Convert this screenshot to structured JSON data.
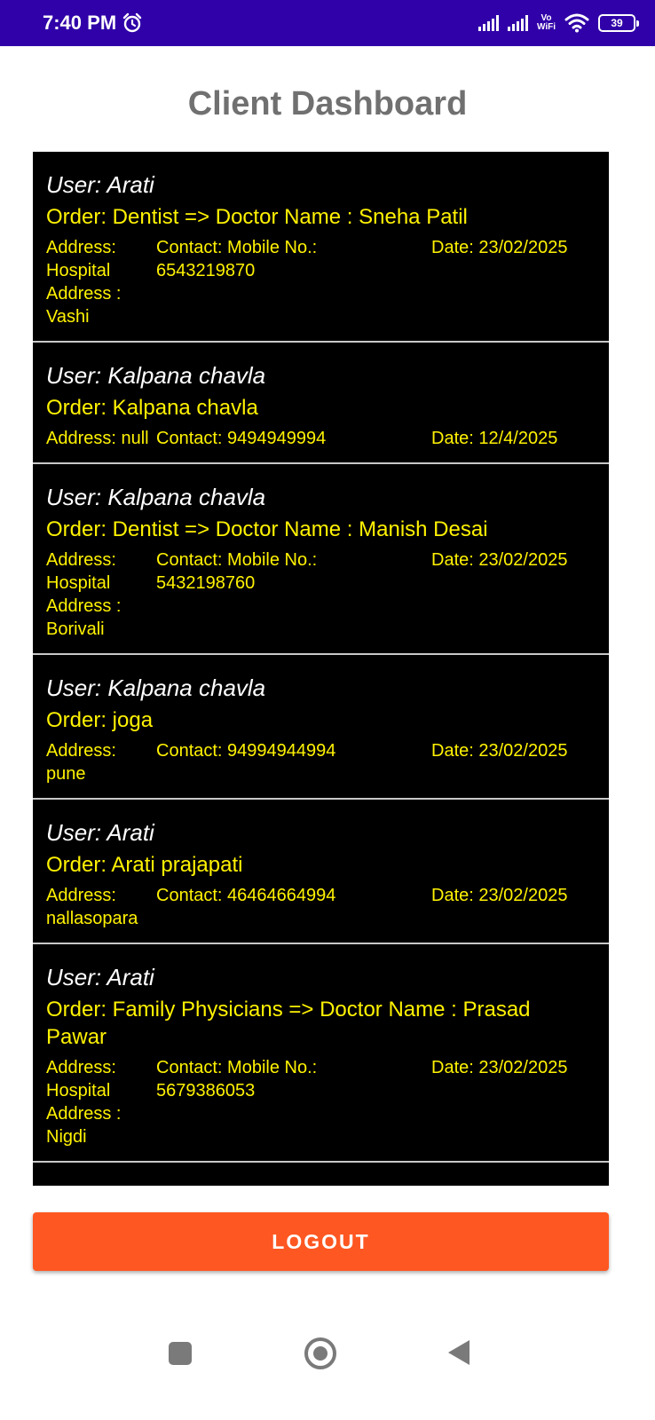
{
  "status_bar": {
    "time": "7:40 PM",
    "alarm_icon": "alarm-clock-icon",
    "vowifi_top": "Vo",
    "vowifi_bottom": "WiFi",
    "battery": "39"
  },
  "page": {
    "title": "Client Dashboard"
  },
  "orders": [
    {
      "user": "User: Arati",
      "order": "Order: Dentist => Doctor Name : Sneha Patil",
      "address": "Address: Hospital Address : Vashi",
      "contact": "Contact: Mobile No.: 6543219870",
      "date": "Date: 23/02/2025"
    },
    {
      "user": "User: Kalpana chavla",
      "order": "Order: Kalpana chavla",
      "address": "Address: null",
      "contact": "Contact: 9494949994",
      "date": "Date: 12/4/2025"
    },
    {
      "user": "User: Kalpana chavla",
      "order": "Order: Dentist => Doctor Name : Manish Desai",
      "address": "Address: Hospital Address : Borivali",
      "contact": "Contact: Mobile No.: 5432198760",
      "date": "Date: 23/02/2025"
    },
    {
      "user": "User: Kalpana chavla",
      "order": "Order: joga",
      "address": "Address: pune",
      "contact": "Contact: 94994944994",
      "date": "Date: 23/02/2025"
    },
    {
      "user": "User: Arati",
      "order": "Order: Arati prajapati",
      "address": "Address: nallasopara",
      "contact": "Contact: 46464664994",
      "date": "Date: 23/02/2025"
    },
    {
      "user": "User: Arati",
      "order": "Order: Family Physicians => Doctor Name : Prasad Pawar",
      "address": "Address: Hospital Address : Nigdi",
      "contact": "Contact: Mobile No.: 5679386053",
      "date": "Date: 23/02/2025"
    }
  ],
  "actions": {
    "logout_label": "LOGOUT"
  },
  "colors": {
    "status_bar": "#3000a8",
    "card_bg": "#000000",
    "user_text": "#ffffff",
    "order_text": "#fff200",
    "logout_bg": "#ff5722",
    "title_text": "#707070"
  },
  "nav_bar": {
    "recents_icon": "square-recents-icon",
    "home_icon": "circle-home-icon",
    "back_icon": "triangle-back-icon"
  }
}
